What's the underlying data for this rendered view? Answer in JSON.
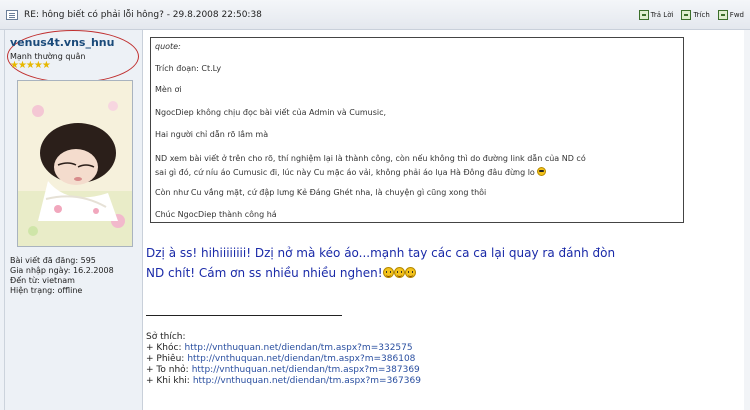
{
  "post": {
    "title": "RE: hông biết có phải lỗi hông? - 29.8.2008 22:50:38",
    "actions": [
      {
        "label": "Trả Lời",
        "icon": "reply-icon"
      },
      {
        "label": "Trích",
        "icon": "quote-icon"
      },
      {
        "label": "Fwd",
        "icon": "forward-icon"
      }
    ]
  },
  "user": {
    "name": "venus4t.vns_hnu",
    "rank": "Mạnh thường quân",
    "stars": "★★★★★",
    "stats": [
      "Bài viết đã đăng: 595",
      "Gia nhập ngày: 16.2.2008",
      "Đến từ: vietnam",
      "Hiện trạng: offline"
    ]
  },
  "quote": {
    "label": "quote:",
    "lines": [
      "Trích đoạn: Ct.Ly",
      "Mèn ơi",
      "NgocDiep không chịu đọc bài viết của Admin và Cumusic,",
      "Hai người chỉ dẫn rõ lắm mà",
      "ND xem bài viết ở trên cho rõ, thí nghiệm lại là thành công, còn nếu không thì do đường link dẫn của ND có",
      "sai gì đó, cứ níu áo Cumusic đi, lúc này Cu mặc áo vải, không phải áo lụa Hà Đông đâu đừng lo",
      "Còn như Cu vắng mặt, cứ đập lưng Kẻ Đáng Ghét nha, là chuyện gì cũng xong thôi",
      "Chúc NgocDiep thành công há"
    ]
  },
  "reply": {
    "line1": "Dzị à ss! hihiiiiiiii! Dzị nở mà kéo áo...mạnh tay các ca ca lại quay ra đánh đòn",
    "line2": "ND chít! Cám ơn ss nhiều nhiều nghen!"
  },
  "hobbies": {
    "heading": "Sở thích:",
    "items": [
      {
        "label": "+ Khóc:",
        "url": "http://vnthuquan.net/diendan/tm.aspx?m=332575"
      },
      {
        "label": "+ Phiêu:",
        "url": "http://vnthuquan.net/diendan/tm.aspx?m=386108"
      },
      {
        "label": "+ To nhỏ:",
        "url": "http://vnthuquan.net/diendan/tm.aspx?m=387369"
      },
      {
        "label": "+ Khi khi:",
        "url": "http://vnthuquan.net/diendan/tm.aspx?m=367369"
      }
    ]
  },
  "colors": {
    "reply_text": "#1a2aa8",
    "username": "#1a4a7a",
    "link": "#2a4fa0",
    "highlight_circle": "#c03030"
  }
}
